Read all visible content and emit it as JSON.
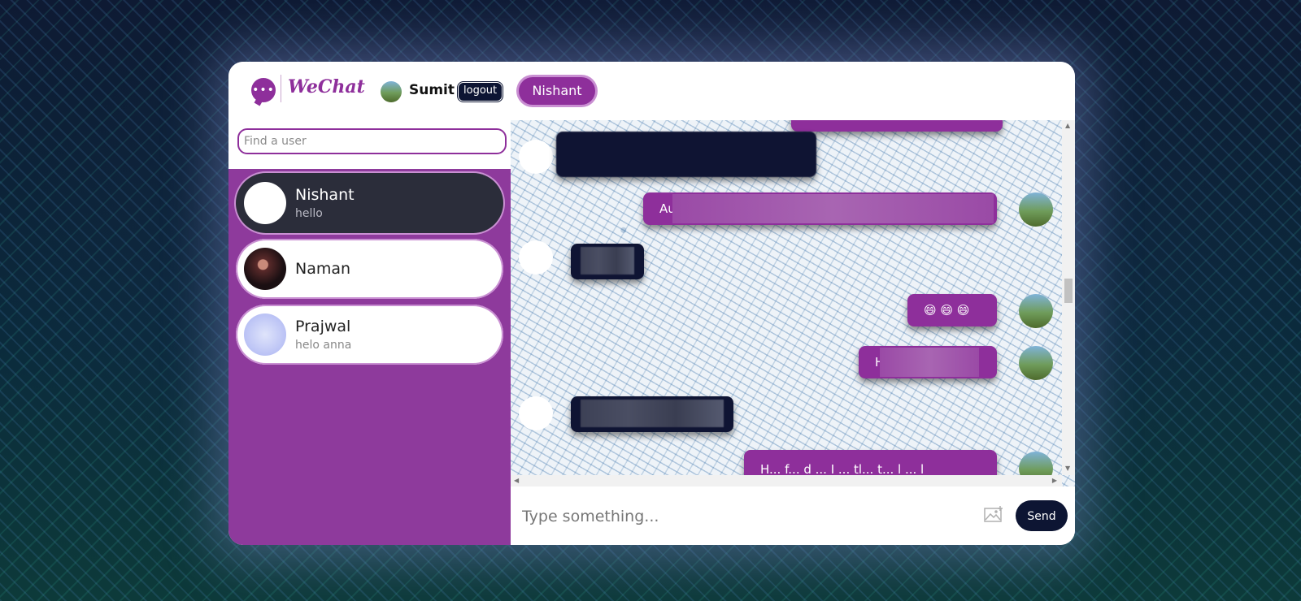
{
  "header": {
    "logo_dots": "•••",
    "logo_text": "WeChat",
    "current_user": "Sumit",
    "logout_label": "logout",
    "active_chat": "Nishant"
  },
  "sidebar": {
    "search_placeholder": "Find a user",
    "users": [
      {
        "name": "Nishant",
        "last_message": "hello",
        "selected": true
      },
      {
        "name": "Naman",
        "last_message": "",
        "selected": false
      },
      {
        "name": "Prajwal",
        "last_message": "helo anna",
        "selected": false
      }
    ]
  },
  "chat": {
    "messages": [
      {
        "from": "them",
        "text": ""
      },
      {
        "from": "me",
        "text": "Au"
      },
      {
        "from": "them",
        "text": ""
      },
      {
        "from": "me",
        "text": "😄 😄 😄"
      },
      {
        "from": "me",
        "text": "H"
      },
      {
        "from": "them",
        "text": ""
      },
      {
        "from": "me",
        "text": "H... f... d ... I ... tl... t... l ... l"
      }
    ]
  },
  "composer": {
    "placeholder": "Type something...",
    "send_label": "Send"
  },
  "colors": {
    "brand_purple": "#8e2f9b",
    "dark_navy": "#0d1533"
  }
}
